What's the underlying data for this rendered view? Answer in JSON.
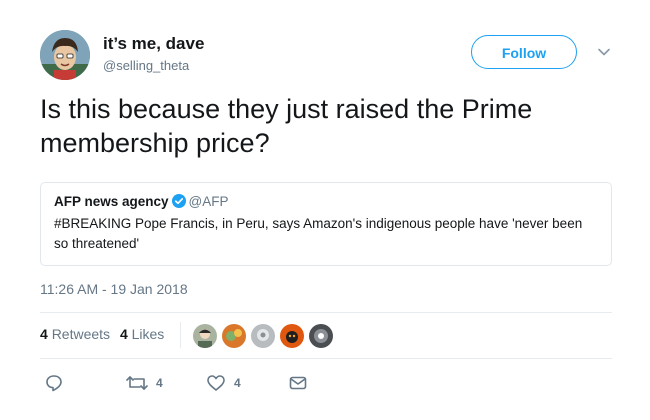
{
  "user": {
    "display_name": "it’s me, dave",
    "handle": "@selling_theta",
    "avatar_icon": "cartoon-avatar-icon"
  },
  "follow_button": {
    "label": "Follow",
    "color": "#1da1f2"
  },
  "menu_icon": "chevron-down-icon",
  "tweet_text": "Is this because they just raised the Prime membership price?",
  "quoted_tweet": {
    "name": "AFP news agency",
    "verified_icon": "verified-badge-icon",
    "handle": "@AFP",
    "text": "#BREAKING Pope Francis, in Peru, says Amazon's indigenous people have 'never been so threatened'"
  },
  "timestamp": "11:26 AM - 19 Jan 2018",
  "stats": {
    "retweets_count": "4",
    "retweets_label": "Retweets",
    "likes_count": "4",
    "likes_label": "Likes"
  },
  "likers": [
    {
      "name": "liker-avatar-1",
      "color": "#a9b3a0"
    },
    {
      "name": "liker-avatar-2",
      "color": "#d9772b"
    },
    {
      "name": "liker-avatar-3",
      "color": "#b8bcbf"
    },
    {
      "name": "liker-avatar-4",
      "color": "#e0580f"
    },
    {
      "name": "liker-avatar-5",
      "color": "#4a4d52"
    }
  ],
  "actions": {
    "reply_icon": "reply-icon",
    "retweet_icon": "retweet-icon",
    "retweet_count": "4",
    "like_icon": "heart-icon",
    "like_count": "4",
    "dm_icon": "envelope-icon"
  },
  "colors": {
    "accent": "#1da1f2",
    "text": "#14171a",
    "secondary": "#657786",
    "border": "#e1e8ed",
    "verified": "#1da1f2"
  }
}
